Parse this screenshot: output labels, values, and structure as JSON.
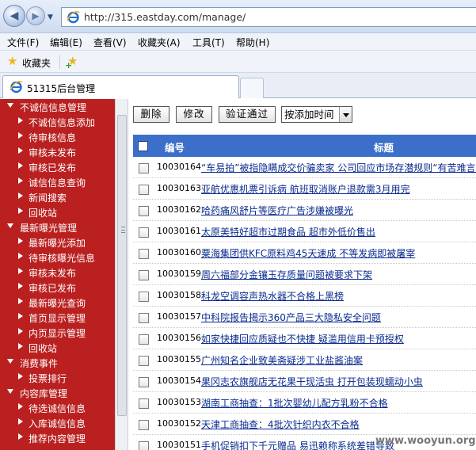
{
  "browser": {
    "url": "http://315.eastday.com/manage/",
    "menu": [
      "文件(F)",
      "编辑(E)",
      "查看(V)",
      "收藏夹(A)",
      "工具(T)",
      "帮助(H)"
    ],
    "favorites_label": "收藏夹",
    "tab_title": "51315后台管理"
  },
  "sidebar": {
    "groups": [
      {
        "label": "不诚信信息管理",
        "items": [
          "不诚信信息添加",
          "待审核信息",
          "审核未发布",
          "审核已发布",
          "诚信信息查询",
          "新闻搜索",
          "回收站"
        ]
      },
      {
        "label": "最新曝光管理",
        "items": [
          "最新曝光添加",
          "待审核曝光信息",
          "审核未发布",
          "审核已发布",
          "最新曝光查询",
          "首页显示管理",
          "内页显示管理",
          "回收站"
        ]
      },
      {
        "label": "消费事件",
        "items": [
          "投票排行"
        ]
      },
      {
        "label": "内容库管理",
        "items": [
          "待选诚信信息",
          "入库诚信信息",
          "推荐内容管理"
        ]
      }
    ]
  },
  "toolbar": {
    "delete_label": "删除",
    "edit_label": "修改",
    "verify_label": "验证通过",
    "sort_value": "按添加时间"
  },
  "table": {
    "headers": {
      "id": "编号",
      "title": "标题"
    },
    "rows": [
      {
        "id": "10030164",
        "title": "“车易拍”被指隐瞒成交价骗卖家 公司回应市场存潜规则“有苦难言”"
      },
      {
        "id": "10030163",
        "title": "亚航优惠机票引诉病 航班取消账户退款需3月用完"
      },
      {
        "id": "10030162",
        "title": "哈药痛风舒片等医疗广告涉嫌被曝光"
      },
      {
        "id": "10030161",
        "title": "太原美特好超市过期食品 超市外低价售出"
      },
      {
        "id": "10030160",
        "title": "粟海集团供KFC原料鸡45天速成 不等发病即被屠宰"
      },
      {
        "id": "10030159",
        "title": "周六福部分金镶玉存质量问题被要求下架"
      },
      {
        "id": "10030158",
        "title": "科龙空调容声热水器不合格上黑榜"
      },
      {
        "id": "10030157",
        "title": "中科院报告揭示360产品三大隐私安全问题"
      },
      {
        "id": "10030156",
        "title": "如家快捷回应质疑也不快捷 疑滥用信用卡预授权"
      },
      {
        "id": "10030155",
        "title": "广州知名企业致美斋疑涉工业盐酱油案"
      },
      {
        "id": "10030154",
        "title": "果冈志农旗舰店无花果干现活虫 打开包装现蠕动小虫"
      },
      {
        "id": "10030153",
        "title": "湖南工商抽查：1批次婴幼儿配方乳粉不合格"
      },
      {
        "id": "10030152",
        "title": "天津工商抽查：4批次针织内衣不合格"
      },
      {
        "id": "10030151",
        "title": "手机促销扣下千元赠品 易迅赖称系统差错导致"
      }
    ]
  },
  "watermark": "www.wooyun.org"
}
